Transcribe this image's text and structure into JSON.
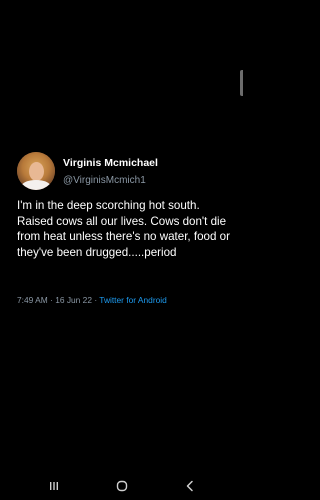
{
  "tweet": {
    "display_name": "Virginis Mcmichael",
    "handle": "@VirginisMcmich1",
    "text": "I'm in the deep scorching hot south. Raised cows all our lives. Cows don't die from heat unless there's no water, food or they've been drugged.....period",
    "time": "7:49 AM",
    "separator": "·",
    "date": "16 Jun 22",
    "source": "Twitter for Android",
    "avatar_icon": "profile-photo"
  },
  "nav": {
    "recent_icon": "recent-apps-icon",
    "home_icon": "home-icon",
    "back_icon": "back-icon"
  },
  "colors": {
    "background": "#000000",
    "text": "#ffffff",
    "muted": "#8b98a5",
    "link": "#1d9bf0"
  }
}
